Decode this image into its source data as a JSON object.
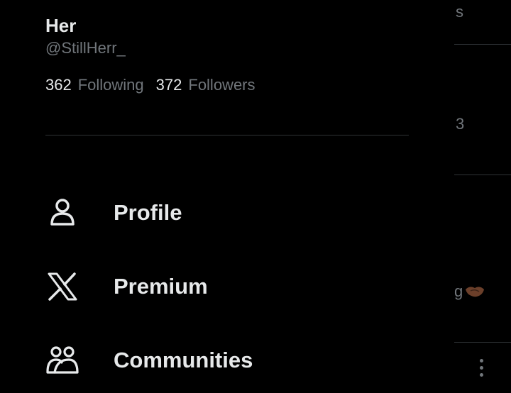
{
  "profile": {
    "display_name": "Her",
    "handle": "@StillHerr_",
    "following_count": "362",
    "following_label": "Following",
    "followers_count": "372",
    "followers_label": "Followers"
  },
  "menu": {
    "items": [
      {
        "label": "Profile",
        "icon": "person-icon"
      },
      {
        "label": "Premium",
        "icon": "x-logo-icon"
      },
      {
        "label": "Communities",
        "icon": "communities-icon"
      }
    ]
  },
  "background_feed": {
    "fragment_1": "s",
    "fragment_2": "3",
    "fragment_3": "g"
  },
  "colors": {
    "background": "#000000",
    "primary_text": "#e7e9ea",
    "secondary_text": "#71767b",
    "divider": "#2f3336"
  }
}
